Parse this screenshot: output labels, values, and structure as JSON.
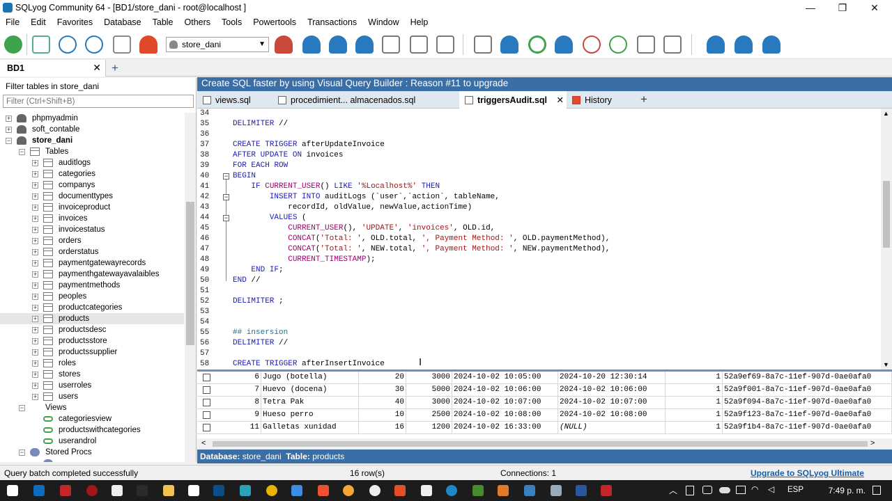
{
  "window": {
    "title": "SQLyog Community 64 - [BD1/store_dani - root@localhost ]"
  },
  "menu": [
    "File",
    "Edit",
    "Favorites",
    "Database",
    "Table",
    "Others",
    "Tools",
    "Powertools",
    "Transactions",
    "Window",
    "Help"
  ],
  "toolbar": {
    "db_selected": "store_dani"
  },
  "connection_tab": {
    "label": "BD1"
  },
  "left": {
    "filter_label": "Filter tables in store_dani",
    "filter_placeholder": "Filter (Ctrl+Shift+B)",
    "databases": [
      "phpmyadmin",
      "soft_contable",
      "store_dani"
    ],
    "tables_label": "Tables",
    "tables": [
      "auditlogs",
      "categories",
      "companys",
      "documenttypes",
      "invoiceproduct",
      "invoices",
      "invoicestatus",
      "orders",
      "orderstatus",
      "paymentgatewayrecords",
      "paymenthgatewayavalaibles",
      "paymentmethods",
      "peoples",
      "productcategories",
      "products",
      "productsdesc",
      "productsstore",
      "productssupplier",
      "roles",
      "stores",
      "userroles",
      "users"
    ],
    "views_label": "Views",
    "views": [
      "categoriesview",
      "productswithcategories",
      "userandrol"
    ],
    "procs_label": "Stored Procs"
  },
  "banner": "Create SQL faster by using Visual Query Builder : Reason #11 to upgrade",
  "editor_tabs": [
    "views.sql",
    "procedimient... almacenados.sql",
    "triggersAudit.sql",
    "History"
  ],
  "code_lines": [
    {
      "n": "34",
      "t": ""
    },
    {
      "n": "35",
      "t": "DELIMITER //"
    },
    {
      "n": "36",
      "t": ""
    },
    {
      "n": "37",
      "t": "CREATE TRIGGER afterUpdateInvoice"
    },
    {
      "n": "38",
      "t": "AFTER UPDATE ON invoices"
    },
    {
      "n": "39",
      "t": "FOR EACH ROW"
    },
    {
      "n": "40",
      "t": "BEGIN"
    },
    {
      "n": "41",
      "t": "    IF CURRENT_USER() LIKE '%Localhost%' THEN"
    },
    {
      "n": "42",
      "t": "        INSERT INTO auditLogs (`user`,`action`, tableName,"
    },
    {
      "n": "43",
      "t": "            recordId, oldValue, newValue,actionTime)"
    },
    {
      "n": "44",
      "t": "        VALUES ("
    },
    {
      "n": "45",
      "t": "            CURRENT_USER(), 'UPDATE', 'invoices', OLD.id,"
    },
    {
      "n": "46",
      "t": "            CONCAT('Total: ', OLD.total, ', Payment Method: ', OLD.paymentMethod),"
    },
    {
      "n": "47",
      "t": "            CONCAT('Total: ', NEW.total, ', Payment Method: ', NEW.paymentMethod),"
    },
    {
      "n": "48",
      "t": "            CURRENT_TIMESTAMP);"
    },
    {
      "n": "49",
      "t": "    END IF;"
    },
    {
      "n": "50",
      "t": "END //"
    },
    {
      "n": "51",
      "t": ""
    },
    {
      "n": "52",
      "t": "DELIMITER ;"
    },
    {
      "n": "53",
      "t": ""
    },
    {
      "n": "54",
      "t": ""
    },
    {
      "n": "55",
      "t": "## insersion"
    },
    {
      "n": "56",
      "t": "DELIMITER //"
    },
    {
      "n": "57",
      "t": ""
    },
    {
      "n": "58",
      "t": "CREATE TRIGGER afterInsertInvoice"
    }
  ],
  "grid_rows": [
    [
      "6",
      "Jugo (botella)",
      "20",
      "3000",
      "2024-10-02 10:05:00",
      "2024-10-20 12:30:14",
      "1",
      "52a9ef69-8a7c-11ef-907d-0ae0afa0"
    ],
    [
      "7",
      "Huevo (docena)",
      "30",
      "5000",
      "2024-10-02 10:06:00",
      "2024-10-02 10:06:00",
      "1",
      "52a9f001-8a7c-11ef-907d-0ae0afa0"
    ],
    [
      "8",
      "Tetra Pak",
      "40",
      "3000",
      "2024-10-02 10:07:00",
      "2024-10-02 10:07:00",
      "1",
      "52a9f094-8a7c-11ef-907d-0ae0afa0"
    ],
    [
      "9",
      "Hueso perro",
      "10",
      "2500",
      "2024-10-02 10:08:00",
      "2024-10-02 10:08:00",
      "1",
      "52a9f123-8a7c-11ef-907d-0ae0afa0"
    ],
    [
      "11",
      "Galletas xunidad",
      "16",
      "1200",
      "2024-10-02 16:33:00",
      "(NULL)",
      "1",
      "52a9f1b4-8a7c-11ef-907d-0ae0afa0"
    ]
  ],
  "infobar": {
    "db_label": "Database:",
    "db": "store_dani",
    "table_label": "Table:",
    "table": "products"
  },
  "status": {
    "message": "Query batch completed successfully",
    "rows": "16 row(s)",
    "connections": "Connections: 1",
    "upgrade": "Upgrade to SQLyog Ultimate"
  },
  "taskbar": {
    "lang": "ESP",
    "time": "7:49 p. m."
  }
}
